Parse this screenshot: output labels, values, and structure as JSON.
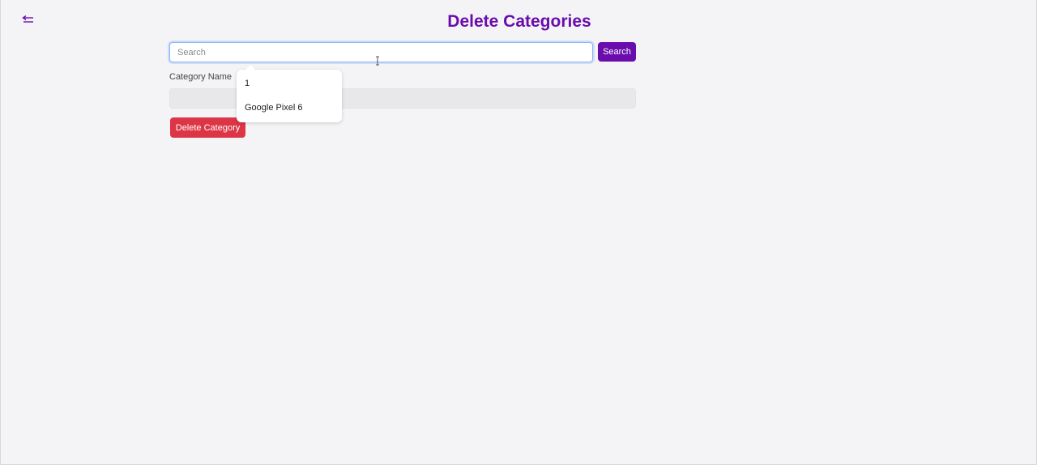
{
  "header": {
    "title": "Delete Categories",
    "back_icon": "arrow-left-icon"
  },
  "search": {
    "placeholder": "Search",
    "value": "",
    "button_label": "Search"
  },
  "suggestions": {
    "items": [
      "1",
      "Google Pixel 6"
    ]
  },
  "form": {
    "category_label": "Category Name",
    "category_value": "",
    "delete_label": "Delete Category"
  },
  "colors": {
    "accent": "#6a0dad",
    "danger": "#dc3545",
    "background": "#f4f4f6"
  }
}
